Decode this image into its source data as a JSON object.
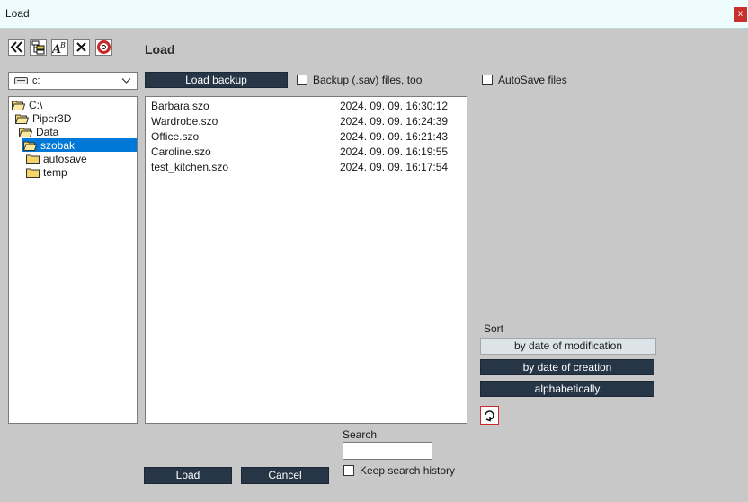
{
  "window": {
    "title": "Load",
    "close_label": "x"
  },
  "toolbar": {
    "icons": [
      "double-chevron-left-icon",
      "tree-icon",
      "rename-icon",
      "delete-icon",
      "help-icon"
    ]
  },
  "heading": "Load",
  "drive": {
    "value": "c:"
  },
  "tree": {
    "nodes": [
      {
        "label": "C:\\"
      },
      {
        "label": "Piper3D"
      },
      {
        "label": "Data"
      },
      {
        "label": "szobak"
      },
      {
        "label": "autosave"
      },
      {
        "label": "temp"
      }
    ]
  },
  "buttons": {
    "load_backup": "Load backup",
    "load": "Load",
    "cancel": "Cancel"
  },
  "options": {
    "backup_files": "Backup (.sav) files, too",
    "autosave_files": "AutoSave files",
    "keep_history": "Keep search history"
  },
  "files": [
    {
      "name": "Barbara.szo",
      "date": "2024. 09. 09. 16:30:12"
    },
    {
      "name": "Wardrobe.szo",
      "date": "2024. 09. 09. 16:24:39"
    },
    {
      "name": "Office.szo",
      "date": "2024. 09. 09. 16:21:43"
    },
    {
      "name": "Caroline.szo",
      "date": "2024. 09. 09. 16:19:55"
    },
    {
      "name": "test_kitchen.szo",
      "date": "2024. 09. 09. 16:17:54"
    }
  ],
  "sort": {
    "label": "Sort",
    "by_modification": "by date of modification",
    "by_creation": "by date of creation",
    "alphabetically": "alphabetically"
  },
  "search": {
    "label": "Search",
    "value": ""
  },
  "colors": {
    "dark_button": "#263646",
    "selected": "#0078d7",
    "close": "#c8302c"
  }
}
